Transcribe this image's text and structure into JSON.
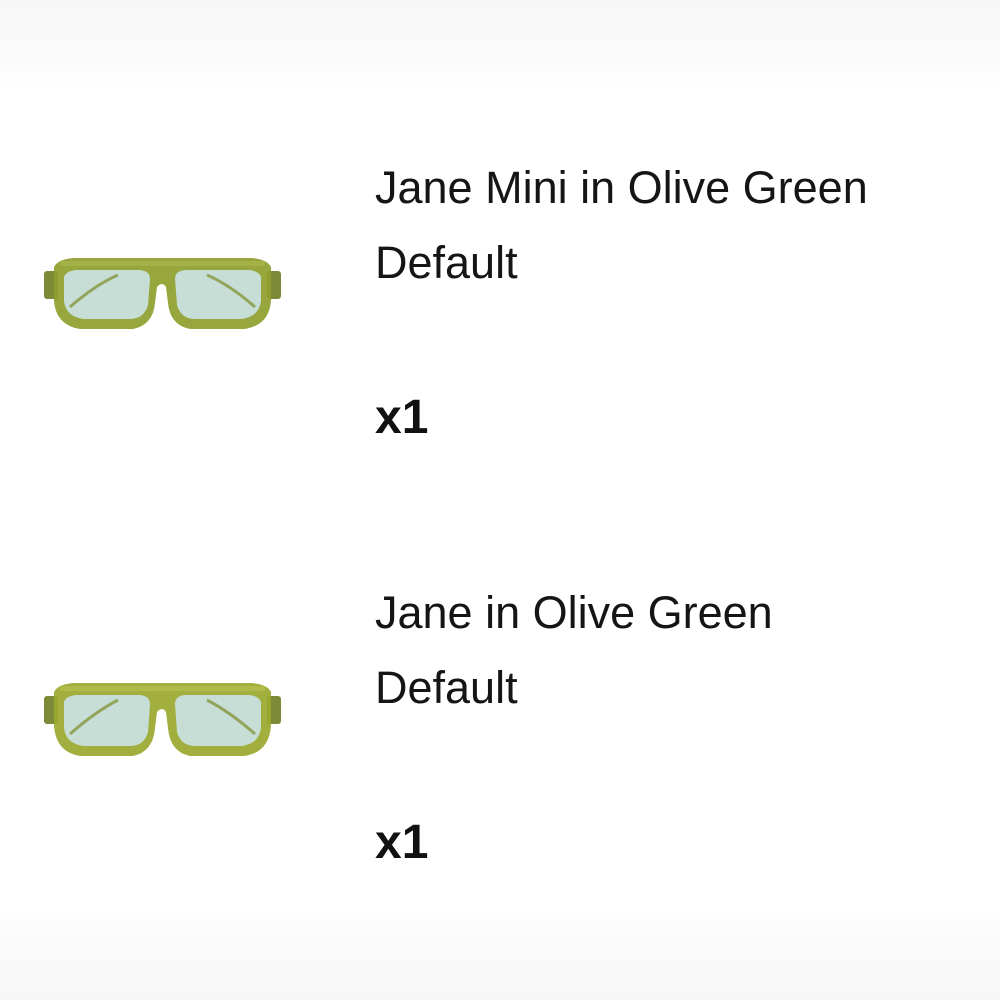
{
  "order": {
    "items": [
      {
        "title": "Jane Mini in Olive Green",
        "variant": "Default",
        "quantity": "x1",
        "image_icon": "sunglasses-olive-green-image"
      },
      {
        "title": "Jane in Olive Green",
        "variant": "Default",
        "quantity": "x1",
        "image_icon": "sunglasses-olive-green-image"
      }
    ]
  },
  "colors": {
    "frame": "#8a9a2e",
    "frame_dark": "#5f6b1c",
    "lens": "#c4ddd4",
    "text": "#151515"
  }
}
